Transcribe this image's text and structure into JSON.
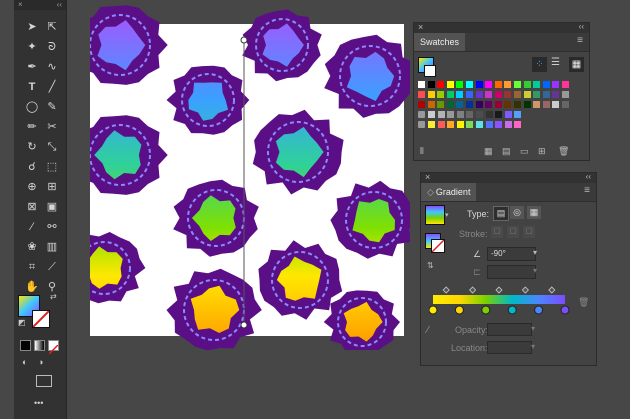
{
  "swatches_panel": {
    "title": "Swatches",
    "colors": [
      [
        "#ffffff",
        "#000000",
        "#ff0000",
        "#ffff00",
        "#00ff00",
        "#00ffff",
        "#0000ff",
        "#ff00ff",
        "#ff6600",
        "#ff9933",
        "#66ff33",
        "#33cc33",
        "#00cc99",
        "#0066ff",
        "#9933ff",
        "#ff3399"
      ],
      [
        "#ff4d4d",
        "#ffcc00",
        "#99cc00",
        "#00cc66",
        "#00ccff",
        "#3366ff",
        "#6633cc",
        "#cc33cc",
        "#cc0066",
        "#993333",
        "#996633",
        "#cccc33",
        "#339966",
        "#336699",
        "#663399",
        "#999999"
      ],
      [
        "#b30000",
        "#cc6600",
        "#669900",
        "#006633",
        "#006699",
        "#003399",
        "#330066",
        "#660066",
        "#990033",
        "#663300",
        "#333300",
        "#003300",
        "#cc9966",
        "#996666",
        "#cccccc",
        "#666666"
      ],
      [
        "#cccccc",
        "#b3b3b3",
        "#999999",
        "#808080",
        "#666666",
        "#4d4d4d",
        "#333333",
        "#1a1a1a",
        "#7a5cff",
        "#55a0ff"
      ],
      [
        "#f9ed32",
        "#ff5b5b",
        "#ffa726",
        "#fff200",
        "#7ed957",
        "#5ce1e6",
        "#5271ff",
        "#8c52ff",
        "#cb6ce6",
        "#ff66c4"
      ]
    ]
  },
  "gradient_panel": {
    "title": "Gradient",
    "type_label": "Type:",
    "stroke_label": "Stroke:",
    "angle": "-90°",
    "opacity_label": "Opacity:",
    "location_label": "Location:",
    "stops": [
      "#ffea00",
      "#ffd700",
      "#7ad000",
      "#00b8c8",
      "#4a86ff",
      "#7b4dff"
    ]
  },
  "tools": {
    "more": "•••"
  },
  "colors": {
    "purple": "#5a0f87",
    "dash": "#8a8aff"
  }
}
